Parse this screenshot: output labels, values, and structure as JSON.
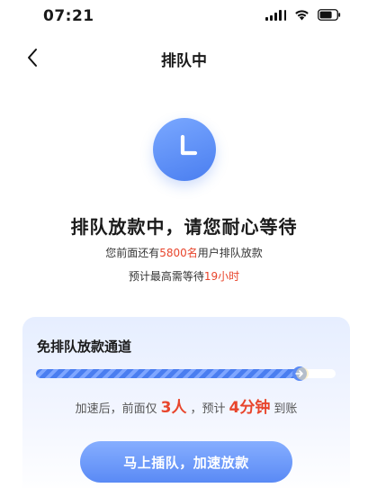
{
  "status_bar": {
    "time": "07:21",
    "icons": [
      "signal-icon",
      "wifi-icon",
      "battery-icon"
    ]
  },
  "nav": {
    "title": "排队中",
    "back_icon": "chevron-left-icon"
  },
  "queue_icon": "clock-icon",
  "queue": {
    "title": "排队放款中，请您耐心等待",
    "line1_prefix": "您前面还有",
    "line1_count": "5800名",
    "line1_suffix": "用户排队放款",
    "line2_prefix": "预计最高需等待",
    "line2_time": "19小时"
  },
  "fast_lane": {
    "title": "免排队放款通道",
    "progress": 0.89,
    "accel_prefix": "加速后，前面仅",
    "accel_people": "3人",
    "accel_mid": "，预计",
    "accel_time": "4分钟",
    "accel_suffix": "到账",
    "button_label": "马上插队，加速放款"
  },
  "colors": {
    "accent_blue": "#4a7ef0",
    "highlight_red": "#e8452c"
  }
}
